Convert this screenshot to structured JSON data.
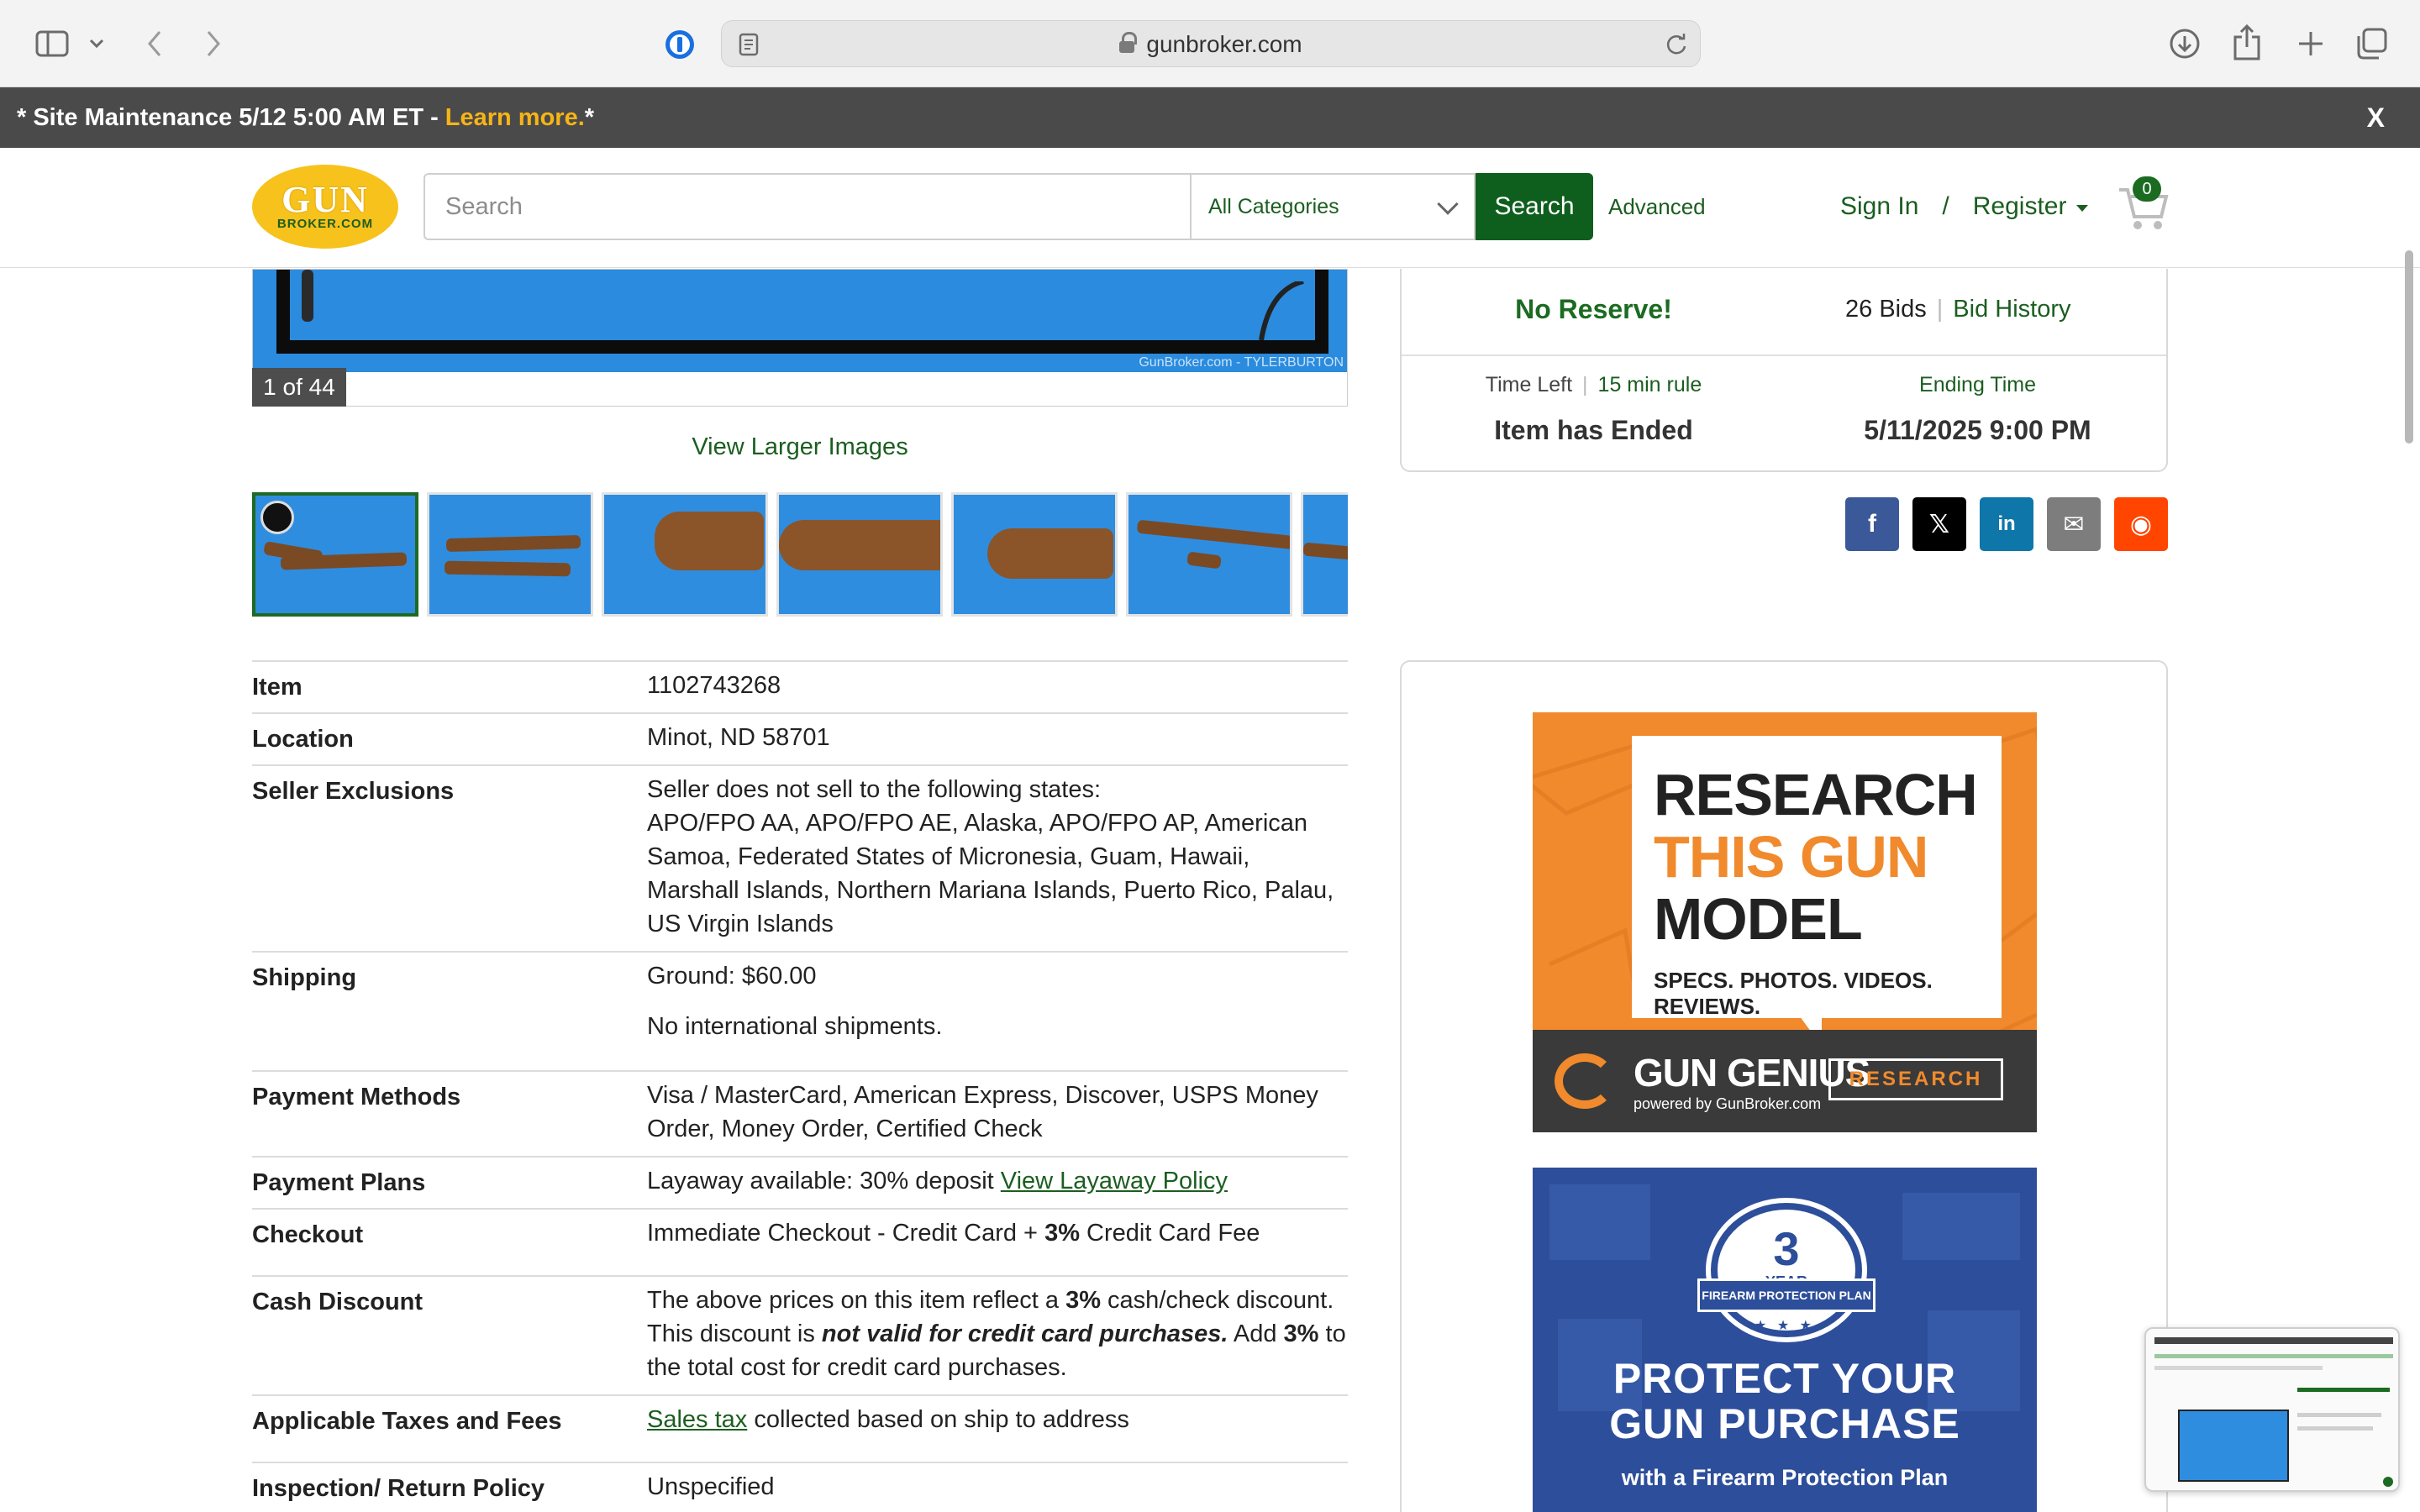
{
  "browser": {
    "url": "gunbroker.com"
  },
  "banner": {
    "text": "* Site Maintenance 5/12 5:00 AM ET - ",
    "link": "Learn more.",
    "suffix": " *",
    "close": "X"
  },
  "header": {
    "logo_top": "GUN",
    "logo_bottom": "BROKER.COM",
    "search_placeholder": "Search",
    "category": "All Categories",
    "search_button": "Search",
    "advanced": "Advanced",
    "sign_in": "Sign In",
    "separator": "/",
    "register": "Register",
    "cart_count": "0"
  },
  "gallery": {
    "counter": "1 of 44",
    "watermark": "GunBroker.com - TYLERBURTON",
    "view_larger": "View Larger Images",
    "thumb_count": 7,
    "selected_thumb": 0
  },
  "details": [
    {
      "label": "Item",
      "lines": [
        "1102743268"
      ]
    },
    {
      "label": "Location",
      "lines": [
        "Minot, ND 58701"
      ]
    },
    {
      "label": "Seller Exclusions",
      "lines": [
        "Seller does not sell to the following states:",
        "APO/FPO AA, APO/FPO AE, Alaska, APO/FPO AP, American",
        "Samoa, Federated States of Micronesia, Guam, Hawaii,",
        "Marshall Islands, Northern Mariana Islands, Puerto Rico, Palau,",
        "US Virgin Islands"
      ]
    },
    {
      "label": "Shipping",
      "lines": [
        "Ground: $60.00"
      ],
      "extra": "No international shipments."
    },
    {
      "label": "Payment Methods",
      "lines": [
        "Visa / MasterCard, American Express, Discover, USPS Money",
        "Order, Money Order, Certified Check"
      ]
    },
    {
      "label": "Payment Plans",
      "prefix": "Layaway available: 30% deposit ",
      "link": "View Layaway Policy"
    },
    {
      "label": "Checkout",
      "prefix": "Immediate Checkout - Credit Card + ",
      "bold": "3%",
      "suffix": " Credit Card Fee"
    },
    {
      "label": "Cash Discount",
      "cash": {
        "p1": "The above prices on this item reflect a ",
        "b1": "3%",
        "p2": " cash/check discount.",
        "p3": "This discount is ",
        "bi": "not valid for credit card purchases.",
        "p4": " Add ",
        "b2": "3%",
        "p5": " to",
        "p6": "the total cost for credit card purchases."
      }
    },
    {
      "label": "Applicable Taxes and Fees",
      "link": "Sales tax",
      "suffix": " collected based on ship to address"
    },
    {
      "label": "Inspection/ Return Policy",
      "lines": [
        "Unspecified"
      ]
    }
  ],
  "bid_box": {
    "no_reserve": "No Reserve!",
    "bids": "26 Bids",
    "bid_history": "Bid History",
    "time_left_label": "Time Left",
    "rule": "15 min rule",
    "time_left_value": "Item has Ended",
    "ending_label": "Ending Time",
    "ending_value": "5/11/2025 9:00 PM"
  },
  "share": [
    {
      "name": "facebook",
      "glyph": "f",
      "color": "#3b5998"
    },
    {
      "name": "x",
      "glyph": "𝕏",
      "color": "#000000"
    },
    {
      "name": "linkedin",
      "glyph": "in",
      "color": "#0e76a8"
    },
    {
      "name": "email",
      "glyph": "✉",
      "color": "#7d7d7d"
    },
    {
      "name": "reddit",
      "glyph": "◉",
      "color": "#ff4500"
    }
  ],
  "ads": {
    "research": {
      "line1": "RESEARCH",
      "line2": "THIS GUN",
      "line3": "MODEL",
      "tagline": "SPECS. PHOTOS. VIDEOS. REVIEWS.",
      "brand": "GUN GENIUS",
      "powered": "powered by GunBroker.com",
      "button": "RESEARCH",
      "accent": "#f08a2c"
    },
    "protect": {
      "years": "3",
      "year_label": "YEAR",
      "ribbon": "FIREARM PROTECTION PLAN",
      "stars": "★ ★ ★",
      "line1": "PROTECT YOUR",
      "line2": "GUN PURCHASE",
      "sub": "with a Firearm Protection Plan",
      "color": "#2d4e9a"
    }
  },
  "colors": {
    "brand_green": "#1b5e20",
    "button_green": "#0e5f1d",
    "banner_bg": "#4a4a4a",
    "banner_link": "#f6b417",
    "logo_yellow": "#f7c21b"
  }
}
